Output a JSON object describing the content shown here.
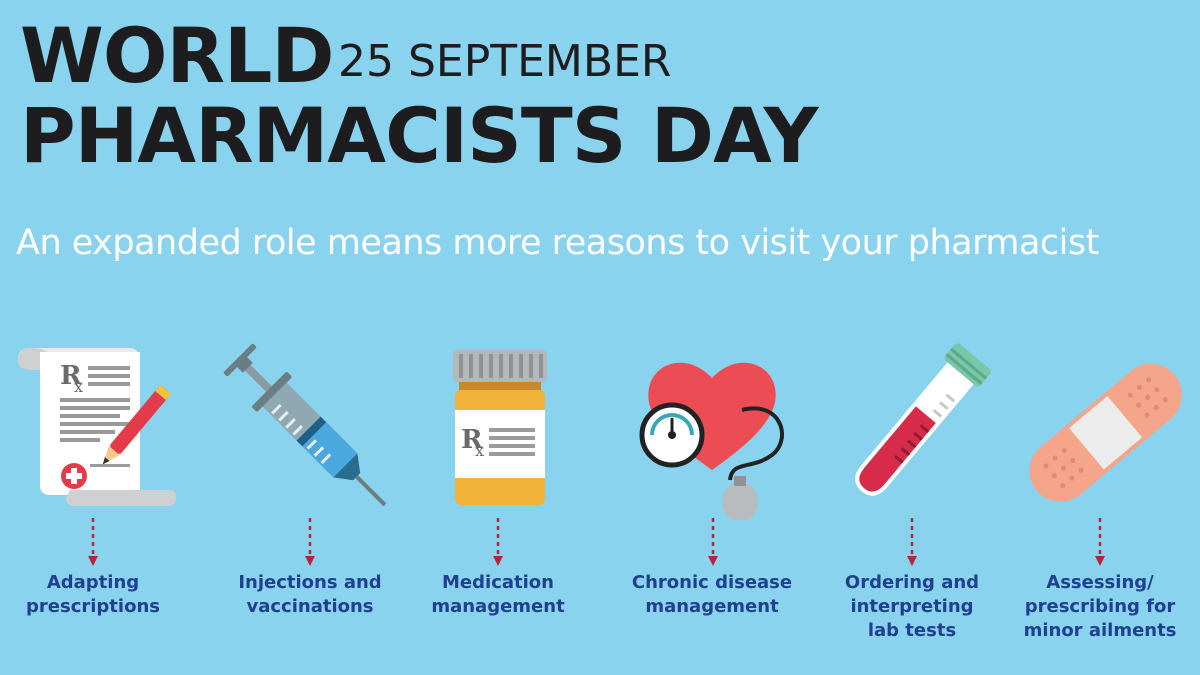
{
  "header": {
    "title_line1": "WORLD",
    "title_line2": "PHARMACISTS DAY",
    "date": "25 SEPTEMBER",
    "subtitle": "An expanded role means more reasons to visit your pharmacist"
  },
  "roles": [
    {
      "icon": "prescription-scroll-icon",
      "label": "Adapting\nprescriptions"
    },
    {
      "icon": "syringe-icon",
      "label": "Injections and\nvaccinations"
    },
    {
      "icon": "pill-bottle-icon",
      "label": "Medication\nmanagement"
    },
    {
      "icon": "heart-blood-pressure-icon",
      "label": "Chronic disease\nmanagement"
    },
    {
      "icon": "test-tube-icon",
      "label": "Ordering and\ninterpreting\nlab tests"
    },
    {
      "icon": "bandage-icon",
      "label": "Assessing/\nprescribing for\nminor ailments"
    }
  ],
  "colors": {
    "background": "#8ad3ef",
    "title": "#1d1d1f",
    "subtitle": "#ffffff",
    "label": "#1f3f8f",
    "arrow": "#b3263a"
  }
}
